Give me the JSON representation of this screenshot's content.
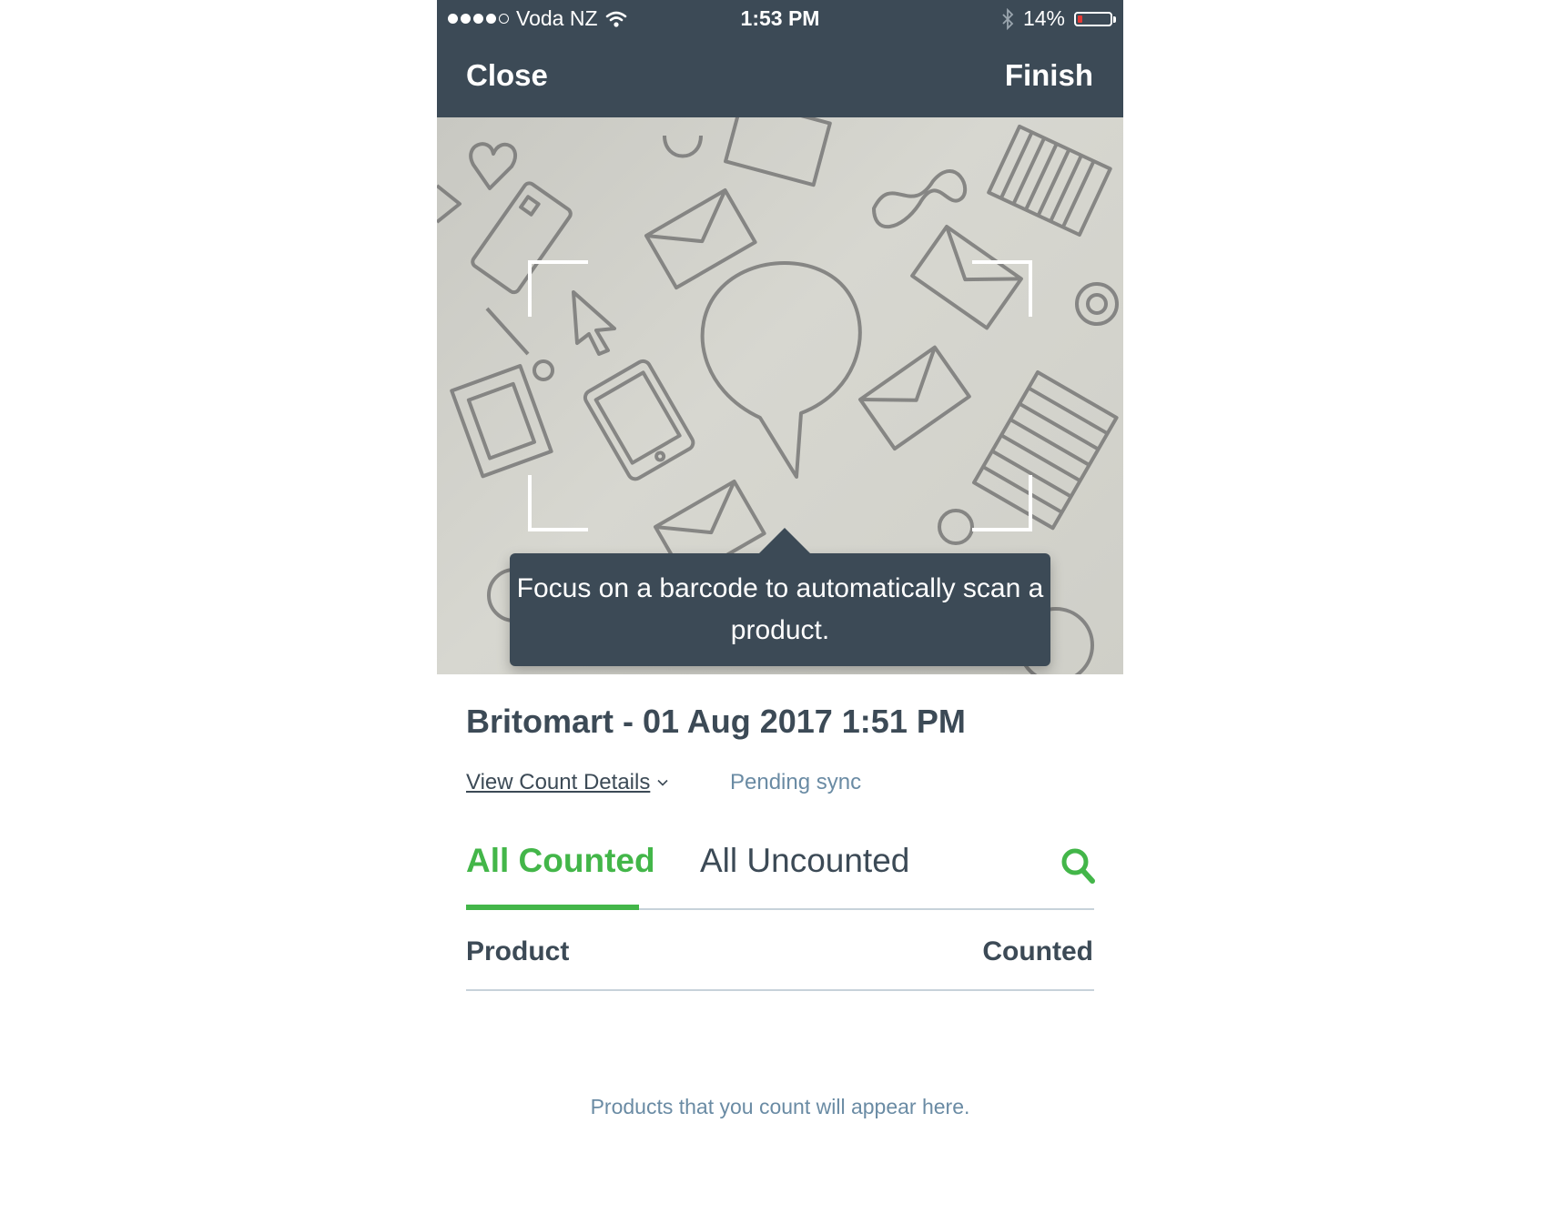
{
  "status_bar": {
    "carrier": "Voda NZ",
    "time": "1:53 PM",
    "battery": "14%",
    "battery_level": 0.14
  },
  "nav": {
    "close_label": "Close",
    "finish_label": "Finish"
  },
  "camera": {
    "tooltip": "Focus on a barcode to automatically scan a product."
  },
  "count": {
    "title": "Britomart - 01 Aug 2017 1:51 PM",
    "details_link": "View Count Details",
    "sync_status": "Pending sync"
  },
  "tabs": [
    {
      "label": "All Counted",
      "active": true
    },
    {
      "label": "All Uncounted",
      "active": false
    }
  ],
  "table": {
    "col_product": "Product",
    "col_counted": "Counted",
    "empty_message": "Products that you count will appear here."
  },
  "colors": {
    "header_bg": "#3c4a56",
    "accent_green": "#43b649",
    "muted_blue": "#6a8ba4",
    "battery_low": "#e53935"
  },
  "icons": [
    "wifi-icon",
    "bluetooth-icon",
    "battery-icon",
    "chevron-down-icon",
    "search-icon"
  ]
}
